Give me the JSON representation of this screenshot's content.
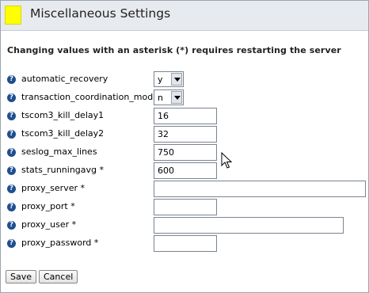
{
  "header": {
    "title": "Miscellaneous Settings",
    "swatch_color": "#ffff00"
  },
  "notice": "Changing values with an asterisk (*) requires restarting the server",
  "help_icon": "?",
  "fields": {
    "automatic_recovery": {
      "label": "automatic_recovery",
      "value": "y"
    },
    "transaction_coordination_mode": {
      "label": "transaction_coordination_mode *",
      "value": "n"
    },
    "tscom3_kill_delay1": {
      "label": "tscom3_kill_delay1",
      "value": "16"
    },
    "tscom3_kill_delay2": {
      "label": "tscom3_kill_delay2",
      "value": "32"
    },
    "seslog_max_lines": {
      "label": "seslog_max_lines",
      "value": "750"
    },
    "stats_runningavg": {
      "label": "stats_runningavg *",
      "value": "600"
    },
    "proxy_server": {
      "label": "proxy_server *",
      "value": ""
    },
    "proxy_port": {
      "label": "proxy_port *",
      "value": ""
    },
    "proxy_user": {
      "label": "proxy_user *",
      "value": ""
    },
    "proxy_password": {
      "label": "proxy_password *",
      "value": ""
    }
  },
  "buttons": {
    "save": "Save",
    "cancel": "Cancel"
  }
}
